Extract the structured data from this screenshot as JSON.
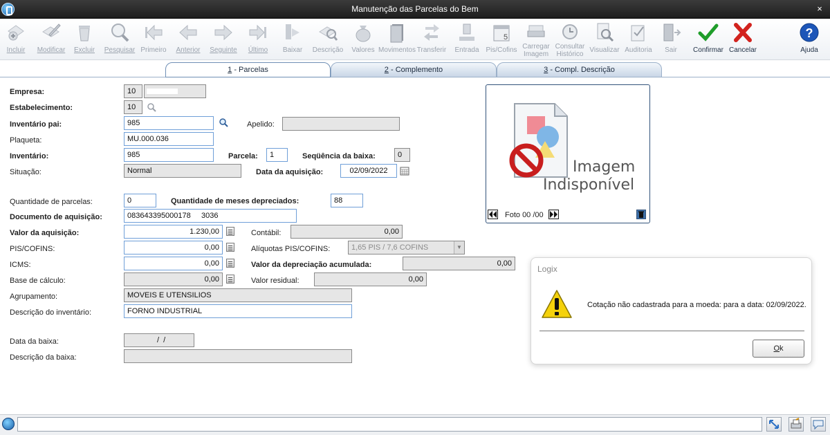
{
  "window": {
    "title": "Manutenção das Parcelas do Bem",
    "close_glyph": "×"
  },
  "toolbar": [
    {
      "label": "Incluir",
      "icon": "add-icon",
      "enabled": false
    },
    {
      "label": "Modificar",
      "icon": "edit-icon",
      "enabled": false
    },
    {
      "label": "Excluir",
      "icon": "trash-icon",
      "enabled": false
    },
    {
      "label": "Pesquisar",
      "icon": "magnifier-icon",
      "enabled": false
    },
    {
      "label": "Primeiro",
      "icon": "first-arrow-icon",
      "enabled": false
    },
    {
      "label": "Anterior",
      "icon": "prev-arrow-icon",
      "enabled": false
    },
    {
      "label": "Seguinte",
      "icon": "next-arrow-icon",
      "enabled": false
    },
    {
      "label": "Último",
      "icon": "last-arrow-icon",
      "enabled": false
    },
    {
      "label": "Baixar",
      "icon": "download-icon",
      "enabled": false
    },
    {
      "label": "Descrição",
      "icon": "description-icon",
      "enabled": false
    },
    {
      "label": "Valores",
      "icon": "money-bag-icon",
      "enabled": false
    },
    {
      "label": "Movimentos",
      "icon": "book-icon",
      "enabled": false
    },
    {
      "label": "Transferir",
      "icon": "transfer-icon",
      "enabled": false
    },
    {
      "label": "Entrada",
      "icon": "entry-icon",
      "enabled": false
    },
    {
      "label": "Pis/Cofins",
      "icon": "calendar-icon",
      "enabled": false
    },
    {
      "label": "Carregar Imagem",
      "icon": "scanner-icon",
      "enabled": false
    },
    {
      "label": "Consultar Histórico",
      "icon": "history-icon",
      "enabled": false
    },
    {
      "label": "Visualizar",
      "icon": "preview-icon",
      "enabled": false
    },
    {
      "label": "Auditoria",
      "icon": "audit-icon",
      "enabled": false
    },
    {
      "label": "Sair",
      "icon": "exit-door-icon",
      "enabled": false
    },
    {
      "label": "Confirmar",
      "icon": "check-icon",
      "enabled": true,
      "color": "#1f9d2a"
    },
    {
      "label": "Cancelar",
      "icon": "cancel-x-icon",
      "enabled": true,
      "color": "#d2231e"
    },
    {
      "label": "Ajuda",
      "icon": "help-icon",
      "enabled": true,
      "color": "#1d56b8"
    }
  ],
  "tabs": [
    {
      "num": "1",
      "label": " - Parcelas",
      "selected": true
    },
    {
      "num": "2",
      "label": " - Complemento",
      "selected": false
    },
    {
      "num": "3",
      "label": " - Compl. Descrição",
      "selected": false
    }
  ],
  "form": {
    "empresa": {
      "label": "Empresa:",
      "value": "10",
      "name": ""
    },
    "estabelecimento": {
      "label": "Estabelecimento:",
      "value": "10"
    },
    "inventario_pai": {
      "label": "Inventário pai:",
      "value": "985"
    },
    "apelido": {
      "label": "Apelido:",
      "value": ""
    },
    "plaqueta": {
      "label": "Plaqueta:",
      "value": "MU.000.036"
    },
    "inventario": {
      "label": "Inventário:",
      "value": "985"
    },
    "parcela": {
      "label": "Parcela:",
      "value": "1"
    },
    "sequencia_baixa": {
      "label": "Seqüência da baixa:",
      "value": "0"
    },
    "situacao": {
      "label": "Situação:",
      "value": "Normal"
    },
    "data_aquisicao": {
      "label": "Data da aquisição:",
      "value": "02/09/2022"
    },
    "qtd_parcelas": {
      "label": "Quantidade de parcelas:",
      "value": "0"
    },
    "qtd_meses": {
      "label": "Quantidade de meses depreciados:",
      "value": "88"
    },
    "documento": {
      "label": "Documento de aquisição:",
      "value": "083643395000178     3036"
    },
    "valor_aquisicao": {
      "label": "Valor da aquisição:",
      "value": "1.230,00"
    },
    "contabil": {
      "label": "Contábil:",
      "value": "0,00"
    },
    "pis_cofins": {
      "label": "PIS/COFINS:",
      "value": "0,00"
    },
    "aliquotas": {
      "label": "Alíquotas PIS/COFINS:",
      "value": "1,65 PIS / 7,6 COFINS"
    },
    "icms": {
      "label": "ICMS:",
      "value": "0,00"
    },
    "valor_depreciacao": {
      "label": "Valor da depreciação acumulada:",
      "value": "0,00"
    },
    "base_calculo": {
      "label": "Base de cálculo:",
      "value": "0,00"
    },
    "valor_residual": {
      "label": "Valor residual:",
      "value": "0,00"
    },
    "agrupamento": {
      "label": "Agrupamento:",
      "value": "MOVEIS E UTENSILIOS"
    },
    "descricao_inventario": {
      "label": "Descrição do inventário:",
      "value": "FORNO INDUSTRIAL"
    },
    "data_baixa": {
      "label": "Data da baixa:",
      "value": "  /  /"
    },
    "descricao_baixa": {
      "label": "Descrição da baixa:",
      "value": ""
    }
  },
  "image_panel": {
    "line1": "Imagem",
    "line2": "Indisponível",
    "foto_label": "Foto 00 /00"
  },
  "dialog": {
    "title": "Logix",
    "message": "Cotação não cadastrada para a moeda:  para a data: 02/09/2022.",
    "ok_label": "k",
    "ok_mnemonic": "O"
  },
  "colors": {
    "accent": "#31527a",
    "confirm": "#1f9d2a",
    "cancel": "#d2231e",
    "help": "#1d56b8"
  }
}
